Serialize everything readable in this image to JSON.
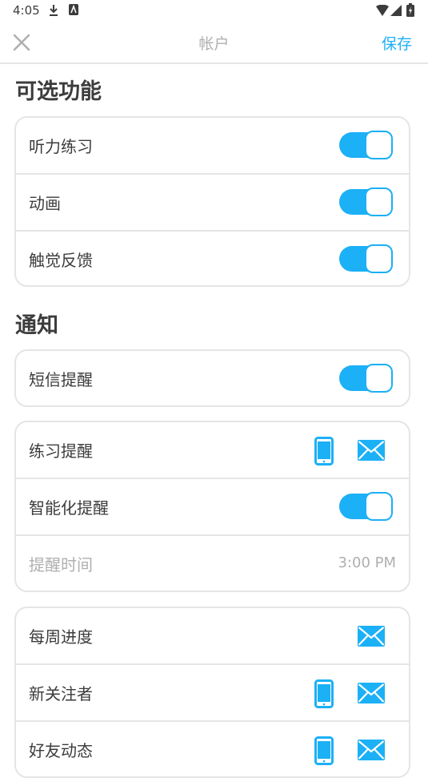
{
  "status_bar": {
    "time": "4:05"
  },
  "header": {
    "title": "帐户",
    "save_label": "保存"
  },
  "sections": {
    "optional": {
      "title": "可选功能",
      "items": [
        {
          "label": "听力练习",
          "enabled": true
        },
        {
          "label": "动画",
          "enabled": true
        },
        {
          "label": "触觉反馈",
          "enabled": true
        }
      ]
    },
    "notifications": {
      "title": "通知",
      "sms": {
        "label": "短信提醒",
        "enabled": true
      },
      "practice": {
        "label": "练习提醒",
        "smart_label": "智能化提醒",
        "smart_enabled": true,
        "time_label": "提醒时间",
        "time_value": "3:00 PM"
      },
      "others": [
        {
          "label": "每周进度"
        },
        {
          "label": "新关注者"
        },
        {
          "label": "好友动态"
        }
      ]
    }
  },
  "colors": {
    "accent": "#1cb0f6",
    "border": "#e5e5e5",
    "muted": "#afafaf"
  }
}
